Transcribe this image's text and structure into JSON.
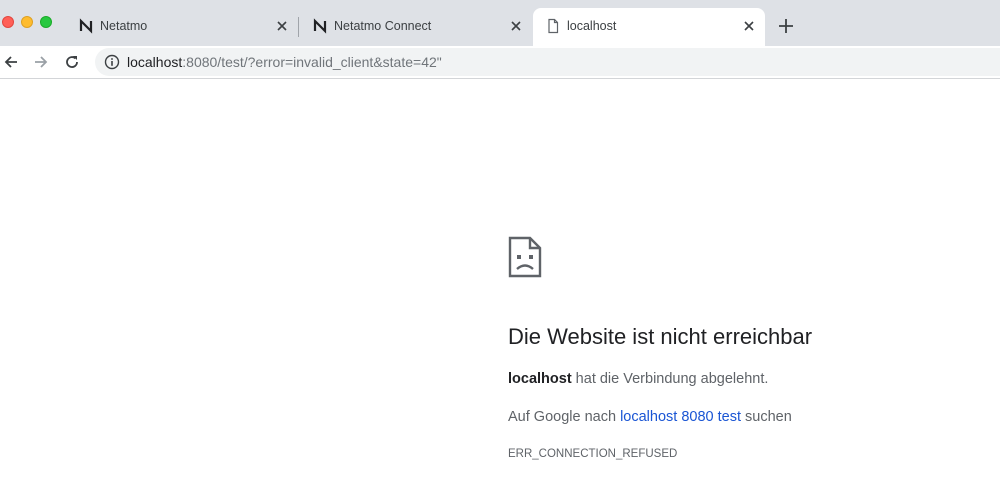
{
  "tabs": [
    {
      "title": "Netatmo",
      "favicon": "netatmo-n-icon",
      "active": false
    },
    {
      "title": "Netatmo Connect",
      "favicon": "netatmo-n-icon",
      "active": false
    },
    {
      "title": "localhost",
      "favicon": "page-icon",
      "active": true
    }
  ],
  "omnibox": {
    "host": "localhost",
    "rest": ":8080/test/?error=invalid_client&state=42\"",
    "icon": "info-icon"
  },
  "error": {
    "icon": "sad-page-icon",
    "title": "Die Website ist nicht erreichbar",
    "host": "localhost",
    "message": " hat die Verbindung abgelehnt.",
    "search_prefix": "Auf Google nach ",
    "search_link": "localhost 8080 test",
    "search_suffix": " suchen",
    "code": "ERR_CONNECTION_REFUSED"
  },
  "colors": {
    "tabstrip": "#dee1e6",
    "link": "#1a55d4",
    "text": "#202124",
    "muted": "#5f6368"
  }
}
